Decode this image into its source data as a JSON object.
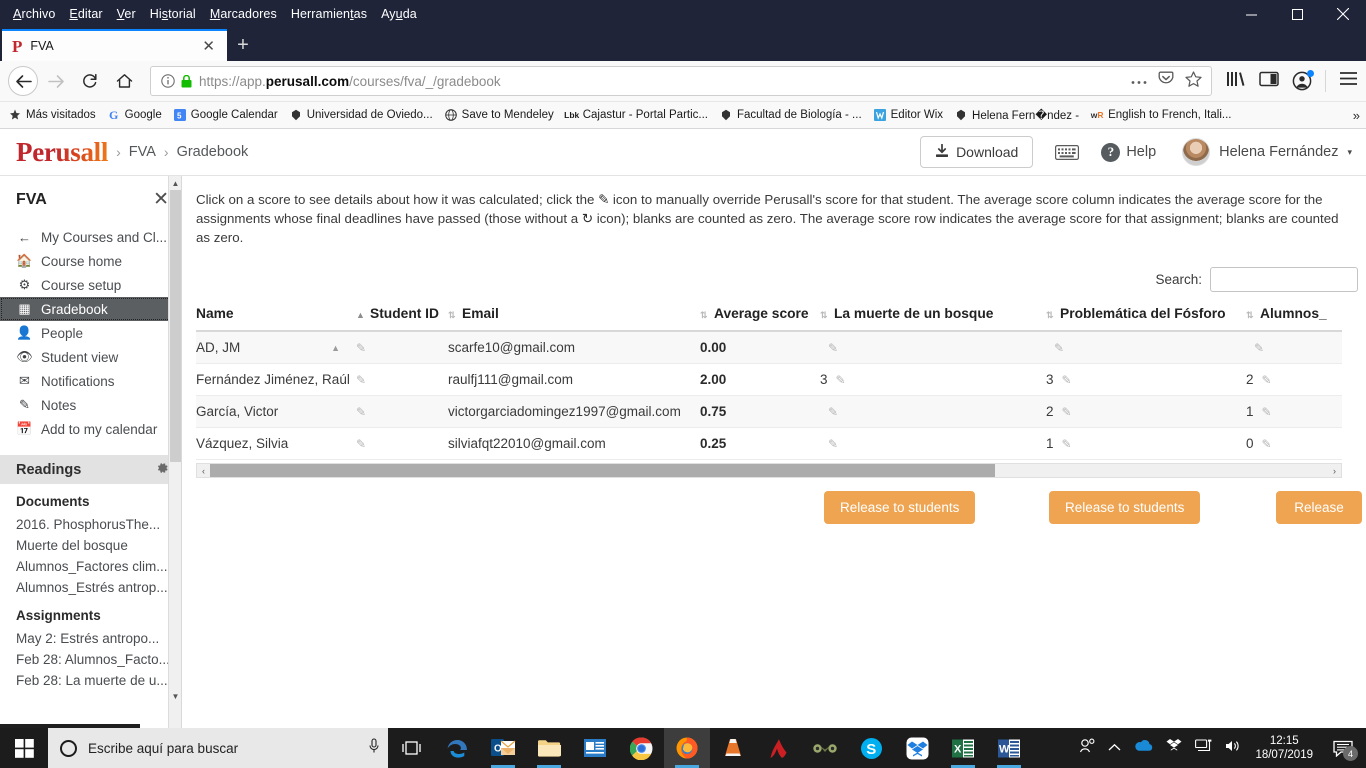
{
  "browser": {
    "menu": [
      "Archivo",
      "Editar",
      "Ver",
      "Historial",
      "Marcadores",
      "Herramientas",
      "Ayuda"
    ],
    "window_controls": {
      "minimize": "minimize-icon",
      "maximize": "maximize-icon",
      "close": "close-icon"
    },
    "tab": {
      "title": "FVA",
      "favicon_letter": "P",
      "close_label": "✕",
      "newtab_label": "+"
    },
    "nav": {
      "back": "←",
      "forward": "→",
      "reload": "↻",
      "home": "⌂"
    },
    "url": {
      "prefix": "https://app.",
      "domain": "perusall.com",
      "path": "/courses/fva/_/gradebook",
      "full": "https://app.perusall.com/courses/fva/_/gradebook"
    },
    "url_icons": [
      "info-icon",
      "lock-icon",
      "ellipsis-icon",
      "pocket-icon",
      "star-icon"
    ],
    "toolbar_icons": [
      "library-icon",
      "sidebar-icon",
      "account-icon",
      "hamburger-menu-icon"
    ],
    "bookmarks": [
      {
        "label": "Más visitados",
        "icon": "star-outline-icon"
      },
      {
        "label": "Google",
        "icon": "google-icon"
      },
      {
        "label": "Google Calendar",
        "icon": "calendar-icon"
      },
      {
        "label": "Universidad de Oviedo...",
        "icon": "crest-icon"
      },
      {
        "label": "Save to Mendeley",
        "icon": "globe-icon"
      },
      {
        "label": "Cajastur - Portal Partic...",
        "icon": "lbk-icon"
      },
      {
        "label": "Facultad de Biología - ...",
        "icon": "crest-icon"
      },
      {
        "label": "Editor Wix",
        "icon": "wix-icon"
      },
      {
        "label": "Helena Fern�ndez -",
        "icon": "crest-icon"
      },
      {
        "label": "English to French, Itali...",
        "icon": "wr-icon"
      }
    ],
    "bookmarks_overflow": "»"
  },
  "app_header": {
    "logo": "Perusall",
    "breadcrumbs": [
      "FVA",
      "Gradebook"
    ],
    "separator": "›",
    "download_label": "Download",
    "keyboard_icon": "keyboard-icon",
    "help_label": "Help",
    "help_glyph": "?",
    "user_name": "Helena Fernández",
    "user_caret": "▾"
  },
  "sidebar": {
    "title": "FVA",
    "close": "✕",
    "items": [
      {
        "label": "My Courses and Cl...",
        "icon": "arrow-left-icon",
        "active": false
      },
      {
        "label": "Course home",
        "icon": "home-icon",
        "active": false
      },
      {
        "label": "Course setup",
        "icon": "gear-icon",
        "active": false
      },
      {
        "label": "Gradebook",
        "icon": "grid-icon",
        "active": true
      },
      {
        "label": "People",
        "icon": "person-icon",
        "active": false
      },
      {
        "label": "Student view",
        "icon": "eye-icon",
        "active": false
      },
      {
        "label": "Notifications",
        "icon": "inbox-icon",
        "active": false
      },
      {
        "label": "Notes",
        "icon": "pencil-icon",
        "active": false
      },
      {
        "label": "Add to my calendar",
        "icon": "calendar-icon",
        "active": false
      }
    ],
    "readings_header": {
      "label": "Readings",
      "gear_icon": "gear-icon"
    },
    "documents_header": "Documents",
    "documents": [
      "2016. PhosphorusThe...",
      "Muerte del bosque",
      "Alumnos_Factores clim...",
      "Alumnos_Estrés antrop..."
    ],
    "assignments_header": "Assignments",
    "assignments": [
      "May 2: Estrés antropo...",
      "Feb 28: Alumnos_Facto...",
      "Feb 28: La muerte de u..."
    ]
  },
  "main": {
    "instructions_part1": "Click on a score to see details about how it was calculated; click the ",
    "instructions_part2": " icon to manually override Perusall's score for that student. The average score column indicates the average score for the assignments whose final deadlines have passed (those without a ",
    "instructions_part3": " icon); blanks are counted as zero. The average score row indicates the average score for that assignment; blanks are counted as zero.",
    "search_label": "Search:",
    "search_value": "",
    "search_placeholder": "",
    "columns": [
      "Name",
      "Student ID",
      "Email",
      "Average score",
      "La muerte de un bosque",
      "Problemática del Fósforo",
      "Alumnos_"
    ],
    "sort_column": "Name",
    "sort_direction": "asc",
    "rows": [
      {
        "name": "AD, JM",
        "student_id": "",
        "email": "scarfe10@gmail.com",
        "average": "0.00",
        "muerte": "",
        "fosforo": "",
        "alumnos": ""
      },
      {
        "name": "Fernández Jiménez, Raúl",
        "student_id": "",
        "email": "raulfj111@gmail.com",
        "average": "2.00",
        "muerte": "3",
        "fosforo": "3",
        "alumnos": "2"
      },
      {
        "name": "García, Victor",
        "student_id": "",
        "email": "victorgarciadomingez1997@gmail.com",
        "average": "0.75",
        "muerte": "",
        "fosforo": "2",
        "alumnos": "1"
      },
      {
        "name": "Vázquez, Silvia",
        "student_id": "",
        "email": "silviafqt22010@gmail.com",
        "average": "0.25",
        "muerte": "",
        "fosforo": "1",
        "alumnos": "0"
      }
    ],
    "release_buttons": [
      "Release to students",
      "Release to students",
      "Release"
    ],
    "release_color": "#efa451",
    "hscroll_left": "‹",
    "hscroll_right": "›"
  },
  "taskbar": {
    "start_icon": "windows-start-icon",
    "search_placeholder": "Escribe aquí para buscar",
    "mic_icon": "microphone-icon",
    "taskview_icon": "task-view-icon",
    "apps": [
      {
        "name": "edge-icon",
        "running": false
      },
      {
        "name": "outlook-icon",
        "running": true
      },
      {
        "name": "file-explorer-icon",
        "running": true
      },
      {
        "name": "publisher-icon",
        "running": false
      },
      {
        "name": "chrome-icon",
        "running": false
      },
      {
        "name": "firefox-icon",
        "running": true,
        "active": true
      },
      {
        "name": "vlc-icon",
        "running": false
      },
      {
        "name": "adobe-icon",
        "running": false
      },
      {
        "name": "mendeley-icon",
        "running": false
      },
      {
        "name": "skype-icon",
        "running": false
      },
      {
        "name": "dropbox-icon",
        "running": false
      },
      {
        "name": "excel-icon",
        "running": true
      },
      {
        "name": "word-icon",
        "running": true
      }
    ],
    "tray_icons": [
      "people-icon",
      "chevron-up-icon",
      "onedrive-icon",
      "dropbox-tray-icon",
      "network-icon",
      "volume-icon"
    ],
    "time": "12:15",
    "date": "18/07/2019",
    "notification_count": "4"
  }
}
